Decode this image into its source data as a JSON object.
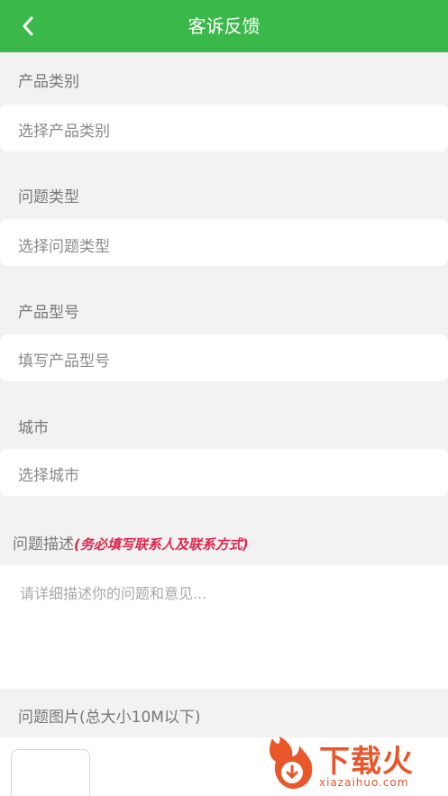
{
  "header": {
    "title": "客诉反馈"
  },
  "form": {
    "product_category": {
      "label": "产品类别",
      "placeholder": "选择产品类别"
    },
    "issue_type": {
      "label": "问题类型",
      "placeholder": "选择问题类型"
    },
    "product_model": {
      "label": "产品型号",
      "placeholder": "填写产品型号"
    },
    "city": {
      "label": "城市",
      "placeholder": "选择城市"
    },
    "description": {
      "label": "问题描述",
      "note": "(务必填写联系人及联系方式)",
      "placeholder": "请详细描述你的问题和意见..."
    },
    "images": {
      "label": "问题图片(总大小10M以下)"
    }
  },
  "watermark": {
    "text_cn": "下载火",
    "text_en": "xiazaihuo.com"
  },
  "colors": {
    "header": "#3bb84a",
    "note": "#e0264f",
    "watermark": "#e8562a"
  }
}
